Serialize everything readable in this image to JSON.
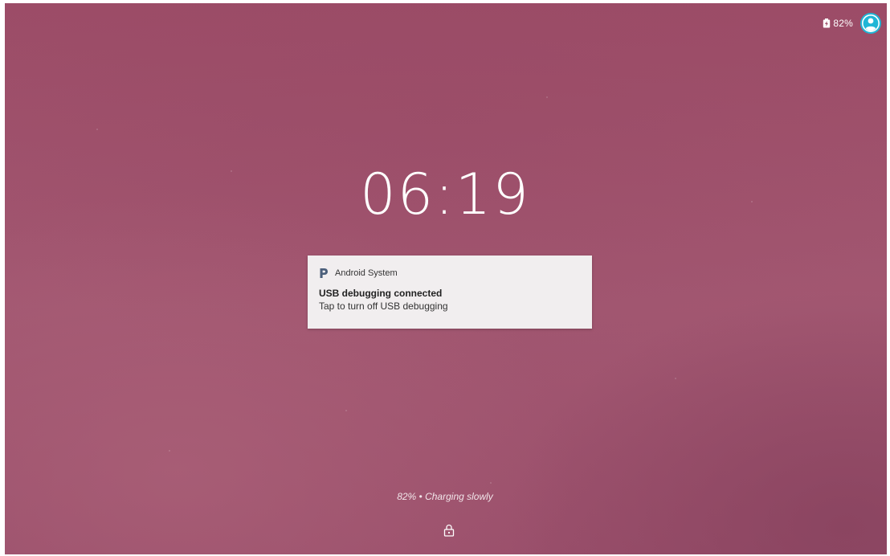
{
  "status_bar": {
    "battery_percent": "82%",
    "battery_icon": "battery-charging-icon",
    "avatar_icon": "user-avatar-icon",
    "avatar_color": "#1fb6d6"
  },
  "lockscreen": {
    "clock": "06:19",
    "charging_status": "82% • Charging slowly",
    "lock_icon": "lock-icon"
  },
  "notification": {
    "app_icon": "android-p-icon",
    "app_name": "Android System",
    "title": "USB debugging connected",
    "text": "Tap to turn off USB debugging"
  },
  "colors": {
    "wallpaper": "#a05470",
    "notification_bg": "#f1eeef",
    "app_icon_color": "#4b5f7a"
  }
}
